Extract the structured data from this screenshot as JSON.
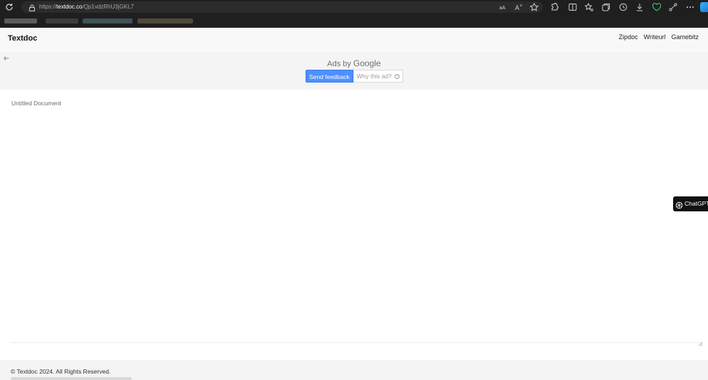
{
  "browser": {
    "url_scheme": "https://",
    "url_host": "textdoc.co",
    "url_path": "/Qp1vdzRhU3jGKL7",
    "icons": [
      "reload-icon",
      "lock-icon",
      "read-aloud-icon",
      "text-size-icon",
      "favorite-star-icon",
      "extensions-icon",
      "split-screen-icon",
      "favorites-icon",
      "collections-icon",
      "history-icon",
      "downloads-icon",
      "browser-essentials-icon",
      "share-icon",
      "more-icon",
      "copilot-icon"
    ]
  },
  "site": {
    "brand": "Textdoc",
    "nav": [
      "Zipdoc",
      "Writeurl",
      "Gamebitz"
    ]
  },
  "ad": {
    "ads_by": "Ads by",
    "google": "Google",
    "send_feedback": "Send feedback",
    "why_this_ad": "Why this ad?",
    "info_glyph": "i"
  },
  "document": {
    "title": "Untitled Document"
  },
  "chatgpt_button": {
    "label": "ChatGPT"
  },
  "footer": {
    "copyright": "© Textdoc 2024. All Rights Reserved."
  },
  "colors": {
    "chrome_bg": "#1f1f1f",
    "accent_button": "#4d90fe",
    "page_band": "#f4f4f5"
  }
}
